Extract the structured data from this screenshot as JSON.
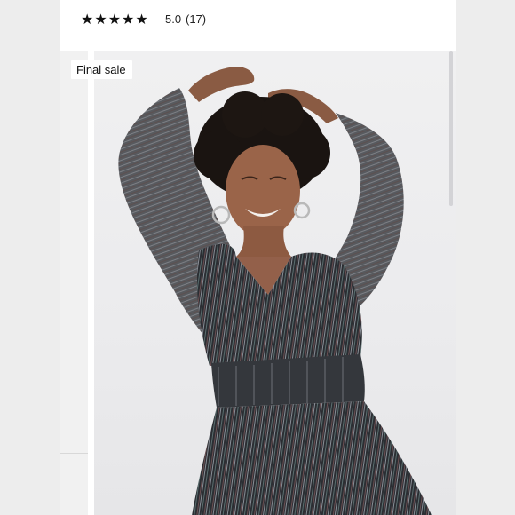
{
  "rating": {
    "stars": [
      "★",
      "★",
      "★",
      "★",
      "★"
    ],
    "value": "5.0",
    "count": "(17)"
  },
  "product": {
    "badge": "Final sale",
    "image_alt": "Model wearing metallic striped long-sleeve wrap dress"
  },
  "colors": {
    "background": "#ececec",
    "card": "#ffffff",
    "dress": "#2a2d31",
    "star": "#111111"
  }
}
